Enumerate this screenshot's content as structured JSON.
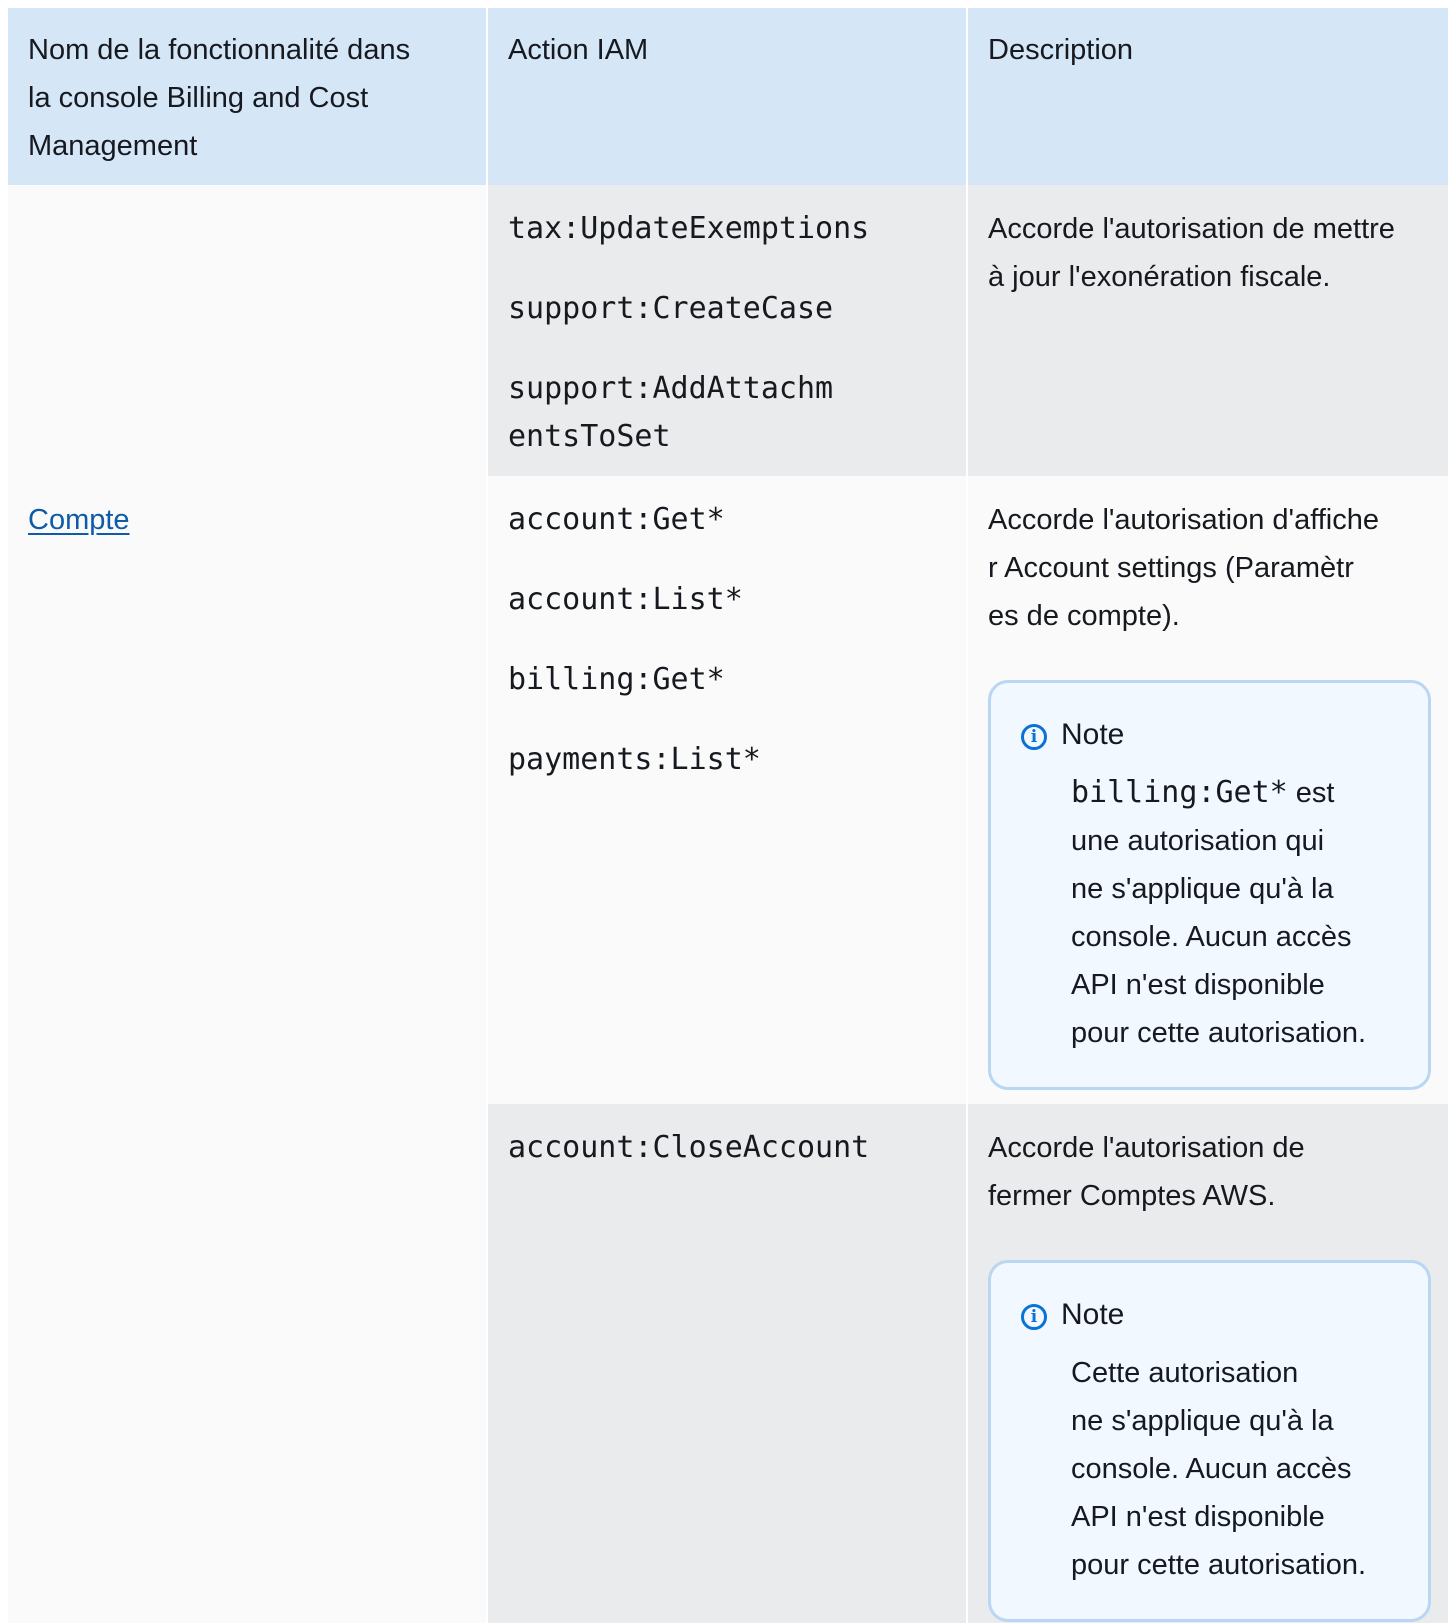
{
  "table": {
    "header": {
      "feature_lines": [
        "Nom de la fonctionnalité dans",
        "la console Billing and Cost",
        "Management"
      ],
      "action": "Action IAM",
      "description": "Description"
    },
    "rows": [
      {
        "actions": [
          "tax:UpdateExemptions",
          "support:CreateCase",
          "support:AddAttachm\nentsToSet"
        ],
        "description": "Accorde l'autorisation de mettre à jour l'exonération fiscale."
      },
      {
        "feature_link": "Compte",
        "actions": [
          "account:Get*",
          "account:List*",
          "billing:Get*",
          "payments:List*"
        ],
        "description_lines": [
          "Accorde l'autorisation d'affiche",
          "r Account settings (Paramètr",
          "es de compte)."
        ],
        "note": {
          "title": "Note",
          "code": "billing:Get*",
          "text_after_code": " est",
          "lines": [
            "une autorisation qui",
            "ne s'applique qu'à la",
            "console. Aucun accès",
            "API n'est disponible",
            "pour cette autorisation."
          ]
        }
      },
      {
        "actions": [
          "account:CloseAccount"
        ],
        "description_lines": [
          "Accorde l'autorisation de",
          "fermer Comptes AWS."
        ],
        "note": {
          "title": "Note",
          "lines": [
            "Cette autorisation",
            "ne s'applique qu'à la",
            "console. Aucun accès",
            "API n'est disponible",
            "pour cette autorisation."
          ]
        }
      }
    ]
  },
  "icons": {
    "note_icon": "info-circle-icon"
  },
  "colors": {
    "header_bg": "#d5e6f7",
    "link": "#0f5ba7",
    "note_border": "#b9d6f2",
    "icon": "#0972d3"
  }
}
